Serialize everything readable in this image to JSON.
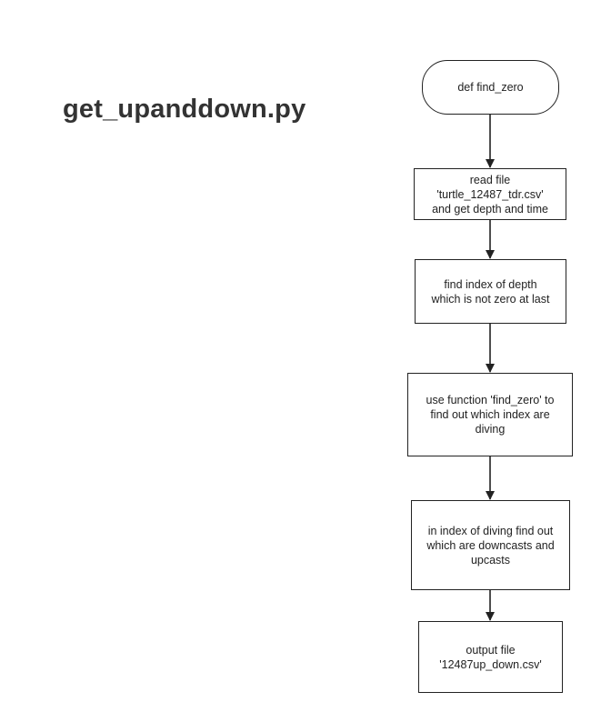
{
  "title": "get_upanddown.py",
  "flow": {
    "start": "def find_zero",
    "steps": [
      "read file\n'turtle_12487_tdr.csv'\nand get depth and time",
      "find index of depth\nwhich is not zero at last",
      "use function 'find_zero' to\nfind out which index are\ndiving",
      "in index of diving find out\nwhich are downcasts and\nupcasts",
      "output file\n'12487up_down.csv'"
    ]
  }
}
